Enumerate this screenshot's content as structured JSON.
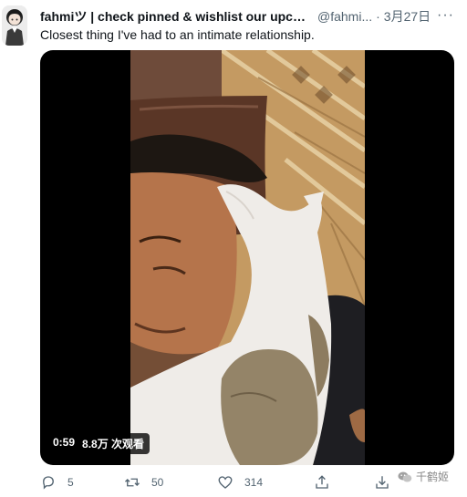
{
  "tweet": {
    "display_name": "fahmiツ | check pinned & wishlist our upcomi...",
    "handle": "@fahmi...",
    "separator": "·",
    "time": "3月27日",
    "more": "···",
    "text": "Closest thing I've had to an intimate relationship."
  },
  "video": {
    "duration": "0:59",
    "views": "8.8万 次观看"
  },
  "actions": {
    "reply_count": "5",
    "retweet_count": "50",
    "like_count": "314"
  },
  "watermark": {
    "label": "千鹤姬"
  },
  "colors": {
    "muted": "#536471",
    "text": "#0f1419",
    "media_bg": "#000000"
  }
}
